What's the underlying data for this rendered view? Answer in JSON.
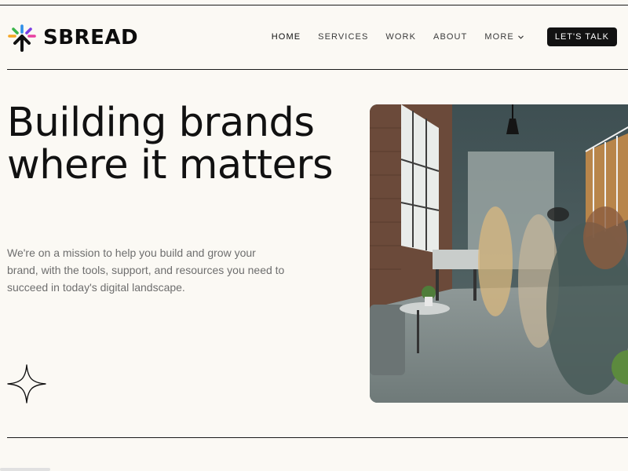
{
  "brand": {
    "name": "SBREAD",
    "logo_icon": "sparkle-arrow-logo-icon"
  },
  "nav": {
    "items": [
      {
        "label": "HOME",
        "active": true
      },
      {
        "label": "SERVICES",
        "active": false
      },
      {
        "label": "WORK",
        "active": false
      },
      {
        "label": "ABOUT",
        "active": false
      }
    ],
    "more_label": "MORE",
    "more_icon": "chevron-down-icon",
    "cta_label": "LET'S TALK"
  },
  "hero": {
    "headline": "Building brands where it matters",
    "subtitle": "We're on a mission to help you build and grow your brand, with the tools, support, and resources you need to succeed in today's digital landscape.",
    "decor_icon": "four-point-star-icon",
    "image_description": "office-loft-photo"
  },
  "colors": {
    "background": "#fbf9f4",
    "text": "#111111",
    "muted_text": "#6e6e6e",
    "cta_bg": "#121212",
    "logo_colors": [
      "#e84a2f",
      "#f5a623",
      "#3ab54a",
      "#2f8fe8",
      "#7b3fe4",
      "#e83fa0"
    ]
  }
}
